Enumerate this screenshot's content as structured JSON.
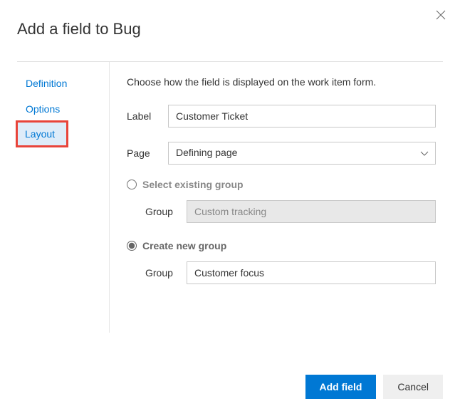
{
  "title": "Add a field to Bug",
  "sidebar": {
    "items": [
      {
        "label": "Definition"
      },
      {
        "label": "Options"
      },
      {
        "label": "Layout"
      }
    ]
  },
  "main": {
    "intro": "Choose how the field is displayed on the work item form.",
    "label_field": {
      "label": "Label",
      "value": "Customer Ticket"
    },
    "page_field": {
      "label": "Page",
      "value": "Defining page"
    },
    "existing_group": {
      "radio_label": "Select existing group",
      "group_label": "Group",
      "group_value": "Custom tracking"
    },
    "new_group": {
      "radio_label": "Create new group",
      "group_label": "Group",
      "group_value": "Customer focus"
    }
  },
  "footer": {
    "primary": "Add field",
    "secondary": "Cancel"
  }
}
